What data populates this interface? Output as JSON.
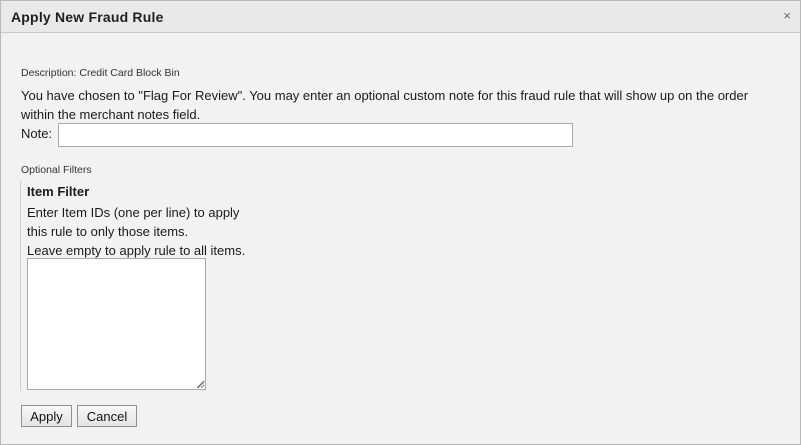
{
  "dialog": {
    "title": "Apply New Fraud Rule",
    "close_glyph": "×"
  },
  "description": {
    "label": "Description: Credit Card Block Bin",
    "message": "You have chosen to \"Flag For Review\". You may enter an optional custom note for this fraud rule that will show up on the order within the merchant notes field."
  },
  "note": {
    "label": "Note:",
    "value": "",
    "placeholder": ""
  },
  "optional_filters": {
    "label": "Optional Filters",
    "item_filter": {
      "title": "Item Filter",
      "line1": "Enter Item IDs (one per line) to apply",
      "line2": "this rule to only those items.",
      "line3": "Leave empty to apply rule to all items.",
      "value": ""
    }
  },
  "buttons": {
    "apply": "Apply",
    "cancel": "Cancel"
  },
  "icons": {
    "close": "close-icon",
    "resize": "resize-grip-icon"
  }
}
